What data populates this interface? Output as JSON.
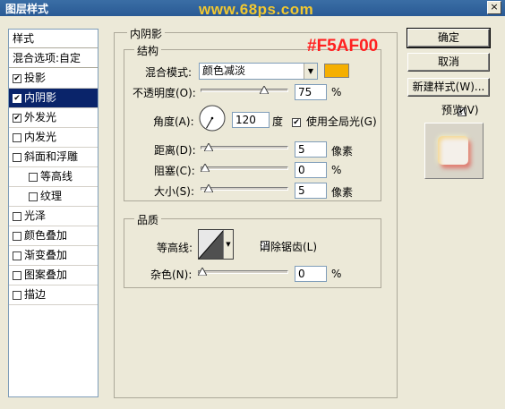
{
  "window": {
    "title": "图层样式",
    "watermark": "www.68ps.com",
    "close": "×"
  },
  "left_panel": {
    "header_styles": "样式",
    "header_blend": "混合选项:自定",
    "items": [
      {
        "label": "投影",
        "checked": true,
        "indent": false
      },
      {
        "label": "内阴影",
        "checked": true,
        "indent": false,
        "selected": true
      },
      {
        "label": "外发光",
        "checked": true,
        "indent": false
      },
      {
        "label": "内发光",
        "checked": false,
        "indent": false
      },
      {
        "label": "斜面和浮雕",
        "checked": false,
        "indent": false
      },
      {
        "label": "等高线",
        "checked": false,
        "indent": true
      },
      {
        "label": "纹理",
        "checked": false,
        "indent": true
      },
      {
        "label": "光泽",
        "checked": false,
        "indent": false
      },
      {
        "label": "颜色叠加",
        "checked": false,
        "indent": false
      },
      {
        "label": "渐变叠加",
        "checked": false,
        "indent": false
      },
      {
        "label": "图案叠加",
        "checked": false,
        "indent": false
      },
      {
        "label": "描边",
        "checked": false,
        "indent": false
      }
    ]
  },
  "inner_shadow": {
    "title": "内阴影",
    "structure": {
      "title": "结构",
      "color_hex_label": "#F5AF00",
      "color": "#F5AF00",
      "blend_mode_label": "混合模式:",
      "blend_mode_value": "颜色减淡",
      "opacity_label": "不透明度(O):",
      "opacity_value": "75",
      "opacity_fraction": 0.75,
      "percent": "%",
      "angle_label": "角度(A):",
      "angle_value": "120",
      "angle_unit": "度",
      "global_light_label": "使用全局光(G)",
      "global_light_checked": true,
      "distance_label": "距离(D):",
      "distance_value": "5",
      "distance_fraction": 0.05,
      "choke_label": "阻塞(C):",
      "choke_value": "0",
      "choke_fraction": 0,
      "size_label": "大小(S):",
      "size_value": "5",
      "size_fraction": 0.05,
      "pixel_unit": "像素"
    },
    "quality": {
      "title": "品质",
      "contour_label": "等高线:",
      "antialias_label": "消除锯齿(L)",
      "antialias_checked": false,
      "noise_label": "杂色(N):",
      "noise_value": "0",
      "noise_fraction": 0
    }
  },
  "buttons": {
    "ok": "确定",
    "cancel": "取消",
    "new_style": "新建样式(W)...",
    "preview_label": "预览(V)",
    "preview_checked": true
  }
}
